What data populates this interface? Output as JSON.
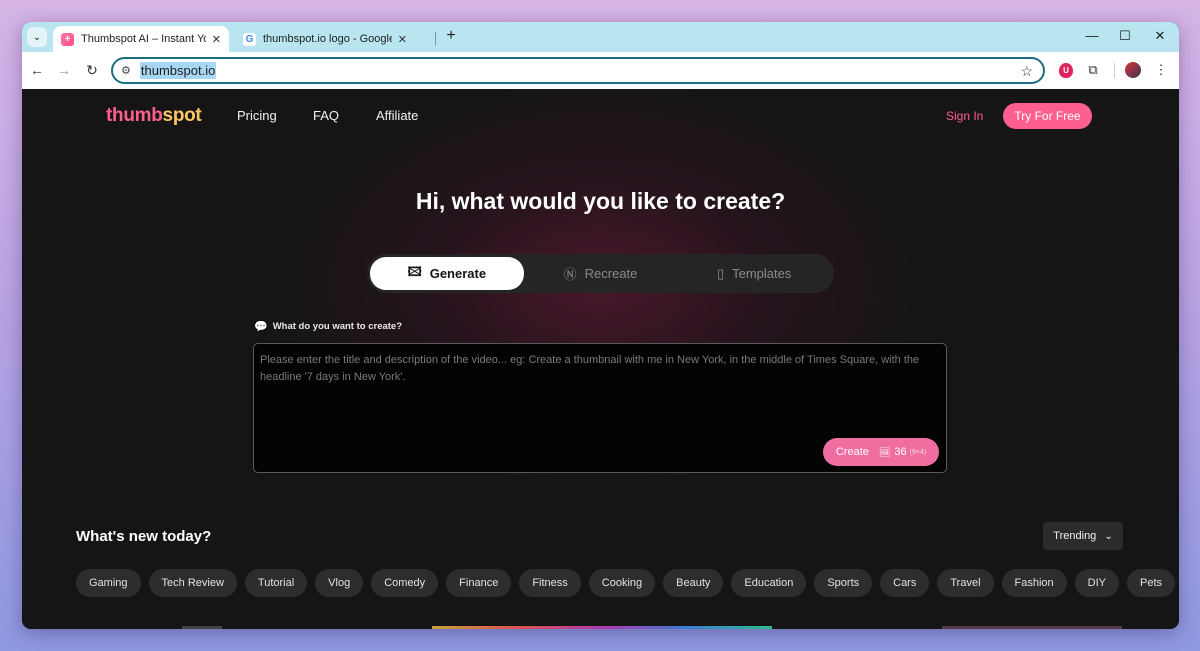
{
  "browser": {
    "tabs": [
      {
        "title": "Thumbspot AI – Instant YouTube",
        "active": true
      },
      {
        "title": "thumbspot.io logo - Google Se",
        "active": false
      }
    ],
    "address": "thumbspot.io"
  },
  "nav": {
    "logo_a": "thumb",
    "logo_b": "spot",
    "links": [
      "Pricing",
      "FAQ",
      "Affiliate"
    ],
    "sign_in": "Sign In",
    "try_free": "Try For Free"
  },
  "hero": {
    "title": "Hi, what would you like to create?"
  },
  "modes": [
    {
      "label": "Generate",
      "icon": "image-sparkle-icon",
      "active": true
    },
    {
      "label": "Recreate",
      "icon": "recreate-icon",
      "active": false
    },
    {
      "label": "Templates",
      "icon": "templates-icon",
      "active": false
    }
  ],
  "prompt": {
    "label": "What do you want to create?",
    "placeholder": "Please enter the title and description of the video... eg: Create a thumbnail with me in New York, in the middle of Times Square, with the headline '7 days in New York'.",
    "create_label": "Create",
    "cost": "36",
    "cost_sub": "(9×4)"
  },
  "feed": {
    "heading": "What's new today?",
    "sort_label": "Trending",
    "categories": [
      "Gaming",
      "Tech Review",
      "Tutorial",
      "Vlog",
      "Comedy",
      "Finance",
      "Fitness",
      "Cooking",
      "Beauty",
      "Education",
      "Sports",
      "Cars",
      "Travel",
      "Fashion",
      "DIY",
      "Pets"
    ]
  },
  "colors": {
    "accent": "#ff5f8f",
    "logo_secondary": "#ffc766",
    "background": "#151515"
  }
}
